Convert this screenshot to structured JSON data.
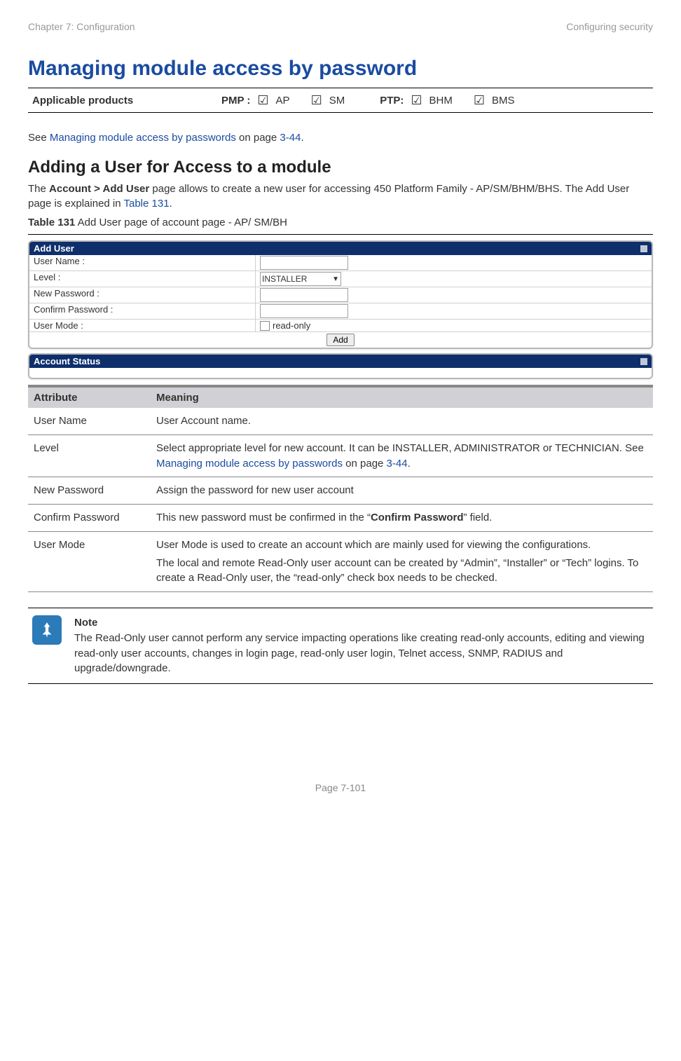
{
  "header": {
    "left": "Chapter 7:  Configuration",
    "right": "Configuring security"
  },
  "title": "Managing module access by password",
  "products": {
    "label": "Applicable products",
    "pmp_label": "PMP :",
    "pmp": [
      {
        "name": "AP"
      },
      {
        "name": "SM"
      }
    ],
    "ptp_label": "PTP:",
    "ptp": [
      {
        "name": "BHM"
      },
      {
        "name": "BMS"
      }
    ]
  },
  "intro": {
    "see_prefix": "See ",
    "link1": "Managing module access by passwords",
    "mid": " on page ",
    "pageref": "3-44",
    "suffix": "."
  },
  "section2": {
    "heading": "Adding a User for Access to a module",
    "p1_a": "The ",
    "p1_b_bold": "Account > Add User",
    "p1_c": " page allows to create a new user for accessing 450 Platform Family - AP/SM/BHM/BHS. The Add User page is explained in ",
    "p1_link": "Table 131",
    "p1_d": "."
  },
  "table_caption_a": "Table 131",
  "table_caption_b": " Add User page of account page - AP/ SM/BH",
  "form": {
    "panel1": "Add User",
    "rows": {
      "username": {
        "label": "User Name :"
      },
      "level": {
        "label": "Level :",
        "value": "INSTALLER"
      },
      "newpw": {
        "label": "New Password :"
      },
      "confirmpw": {
        "label": "Confirm Password :"
      },
      "usermode": {
        "label": "User Mode :",
        "option": "read-only"
      }
    },
    "add_btn": "Add",
    "panel2": "Account Status"
  },
  "attr_table": {
    "col1": "Attribute",
    "col2": "Meaning",
    "rows": [
      {
        "attr": "User Name",
        "meaning": "User Account name."
      },
      {
        "attr": "Level",
        "meaning_a": "Select appropriate level for new account. It can be INSTALLER, ADMINISTRATOR or TECHNICIAN. See ",
        "link1": "Managing module access by passwords",
        "mid": " on page ",
        "pageref": "3-44",
        "suffix": "."
      },
      {
        "attr": "New Password",
        "meaning": "Assign the password for new user account"
      },
      {
        "attr": "Confirm Password",
        "meaning_a": "This new password must be confirmed in the “",
        "bold": "Confirm Password",
        "meaning_b": "” field."
      },
      {
        "attr": "User Mode",
        "p1": "User Mode is used to create an account which are mainly used for viewing the configurations.",
        "p2": "The local and remote Read-Only user account can be created by “Admin”, “Installer” or “Tech” logins. To create a Read-Only user, the “read-only” check box needs to be checked."
      }
    ]
  },
  "note": {
    "title": "Note",
    "body": "The Read-Only user cannot perform any service impacting operations like creating read-only accounts, editing and viewing read-only user accounts, changes in login page, read-only user login, Telnet access, SNMP, RADIUS and upgrade/downgrade."
  },
  "footer": "Page 7-101"
}
